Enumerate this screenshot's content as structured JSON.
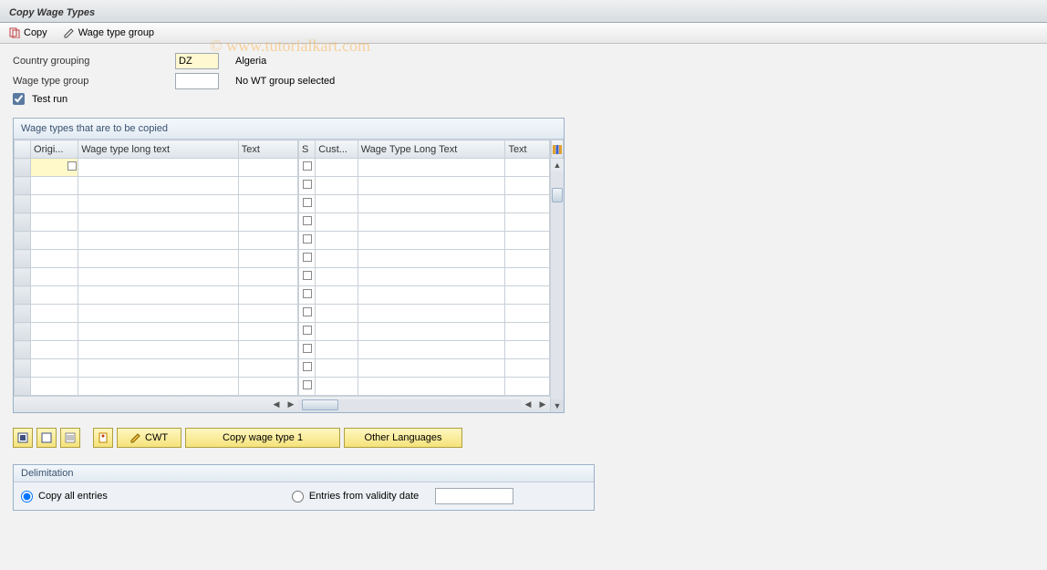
{
  "header": {
    "title": "Copy Wage Types"
  },
  "toolbar": {
    "copy": "Copy",
    "wage_type_group": "Wage type group"
  },
  "fields": {
    "country_grouping_label": "Country grouping",
    "country_grouping_value": "DZ",
    "country_grouping_text": "Algeria",
    "wage_type_group_label": "Wage type group",
    "wage_type_group_value": "",
    "wage_type_group_text": "No WT group selected",
    "test_run_label": "Test run"
  },
  "grid": {
    "title": "Wage types that are to be copied",
    "cols_left": {
      "origi": "Origi...",
      "wtlt": "Wage type long text",
      "text": "Text"
    },
    "cols_right": {
      "s": "S",
      "cust": "Cust...",
      "wtlt2": "Wage Type Long Text",
      "text2": "Text"
    },
    "row_count": 13
  },
  "buttons": {
    "cwt": "CWT",
    "copy_wt1": "Copy wage type 1",
    "other_lang": "Other Languages"
  },
  "delim": {
    "title": "Delimitation",
    "copy_all": "Copy all entries",
    "from_date": "Entries from validity date"
  },
  "watermark": "© www.tutorialkart.com"
}
